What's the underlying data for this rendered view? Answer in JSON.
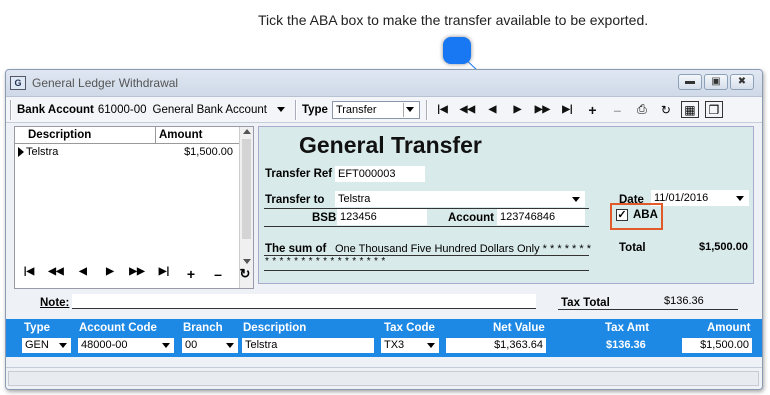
{
  "callout": {
    "text": "Tick the ABA box to make the transfer available to be exported."
  },
  "window": {
    "title": "General Ledger Withdrawal",
    "icon_label": "G",
    "buttons": [
      "minimize",
      "restore",
      "close"
    ]
  },
  "toolbar": {
    "bank_account_label": "Bank Account",
    "bank_account_code": "61000-00",
    "bank_account_name": "General Bank Account",
    "type_label": "Type",
    "type_value": "Transfer",
    "nav": [
      "first",
      "prev-page",
      "prev",
      "next",
      "next-page",
      "last",
      "add",
      "delete",
      "print",
      "refresh",
      "report",
      "copy"
    ]
  },
  "list": {
    "columns": [
      "Description",
      "Amount"
    ],
    "rows": [
      {
        "description": "Telstra",
        "amount": "$1,500.00"
      }
    ],
    "nav": [
      "first",
      "prev-page",
      "prev",
      "next",
      "next-page",
      "last",
      "add",
      "delete",
      "refresh"
    ]
  },
  "transfer": {
    "title": "General Transfer",
    "transfer_ref_label": "Transfer Ref",
    "transfer_ref": "EFT000003",
    "transfer_to_label": "Transfer to",
    "transfer_to": "Telstra",
    "bsb_label": "BSB",
    "bsb": "123456",
    "account_label": "Account",
    "account": "123746846",
    "date_label": "Date",
    "date": "11/01/2016",
    "aba_label": "ABA",
    "aba_checked": true,
    "sum_label": "The sum of",
    "sum_text": "One Thousand Five Hundred Dollars Only * * * * * * *",
    "sum_stars": "* * * * * * * * * * * * * * * * *",
    "total_label": "Total",
    "total": "$1,500.00"
  },
  "note": {
    "label": "Note:",
    "value": "",
    "tax_total_label": "Tax Total",
    "tax_total": "$136.36"
  },
  "detail": {
    "headers": {
      "type": "Type",
      "account_code": "Account Code",
      "branch": "Branch",
      "description": "Description",
      "tax_code": "Tax Code",
      "net_value": "Net Value",
      "tax_amt": "Tax Amt",
      "amount": "Amount"
    },
    "row": {
      "type": "GEN",
      "account_code": "48000-00",
      "branch": "00",
      "description": "Telstra",
      "tax_code": "TX3",
      "net_value": "$1,363.64",
      "tax_amt": "$136.36",
      "amount": "$1,500.00"
    }
  },
  "colors": {
    "accent_blue": "#1e88e5",
    "highlight": "#e05a2a",
    "panel": "#d9eaea"
  }
}
